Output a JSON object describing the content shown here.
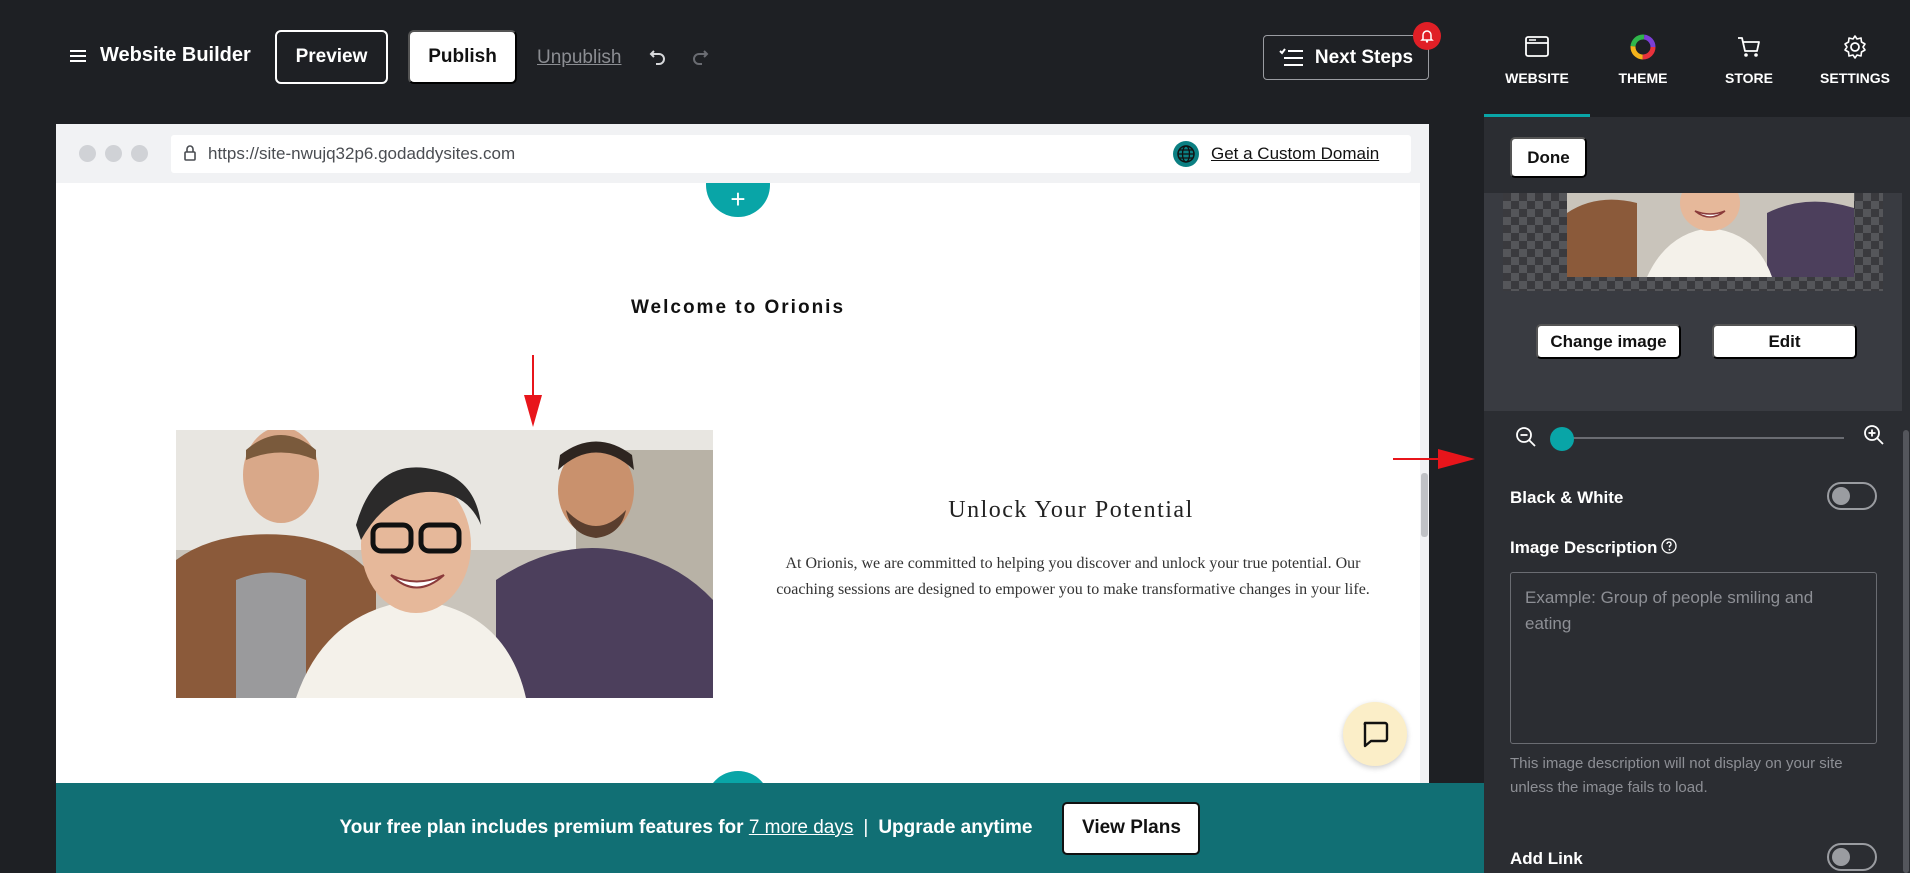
{
  "header": {
    "brand": "Website Builder",
    "preview_label": "Preview",
    "publish_label": "Publish",
    "unpublish_label": "Unpublish",
    "next_steps_label": "Next Steps"
  },
  "browser": {
    "url": "https://site-nwujq32p6.godaddysites.com",
    "custom_domain_label": "Get a Custom Domain"
  },
  "site": {
    "welcome": "Welcome to Orionis",
    "add_section_symbol": "+",
    "hero_title": "Unlock Your Potential",
    "hero_text": "At Orionis, we are committed to helping you discover and unlock your true potential. Our coaching sessions are designed to empower you to make transformative changes in your life."
  },
  "banner": {
    "text_before": "Your free plan includes premium features for",
    "link": "7 more days",
    "separator": "|",
    "text_after": "Upgrade anytime",
    "view_plans_label": "View Plans"
  },
  "panel": {
    "tabs": [
      {
        "label": "WEBSITE",
        "icon": "browser-window-icon",
        "active": true
      },
      {
        "label": "THEME",
        "icon": "color-wheel-icon",
        "active": false
      },
      {
        "label": "STORE",
        "icon": "cart-icon",
        "active": false
      },
      {
        "label": "SETTINGS",
        "icon": "gear-icon",
        "active": false
      }
    ],
    "done_label": "Done",
    "change_image_label": "Change image",
    "edit_label": "Edit",
    "zoom_level": 0,
    "black_white_label": "Black & White",
    "black_white_on": false,
    "image_description_label": "Image Description",
    "image_description_placeholder": "Example: Group of people smiling and eating",
    "image_description_help": "This image description will not display on your site unless the image fails to load.",
    "add_link_label": "Add Link",
    "add_link_on": false
  },
  "colors": {
    "accent": "#09a5a7",
    "banner": "#116f74",
    "annotation_arrow": "#e8151b",
    "dark_bg": "#1e2024",
    "panel_bg": "#2b2d32"
  }
}
